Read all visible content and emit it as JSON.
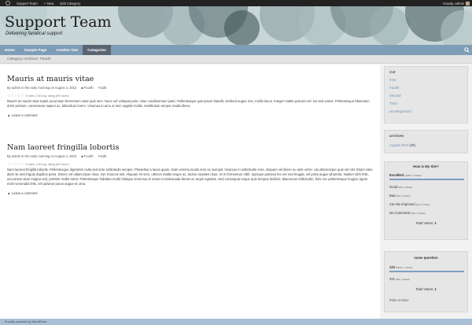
{
  "adminbar": {
    "site": "Support Team",
    "new": "New",
    "edit": "Edit Category",
    "howdy": "Howdy, admin"
  },
  "header": {
    "title": "Support Team",
    "description": "Delivering fanatical support"
  },
  "nav": {
    "items": [
      "Home",
      "Sample Page",
      "Another One",
      "Categories"
    ],
    "active_index": 3
  },
  "breadcrumb": "Category Archives: Fourth",
  "posts": [
    {
      "title": "Mauris at mauris vitae",
      "meta_by": "By admin in the early morning on August 4, 2013",
      "category": "Fourth",
      "edit": "Edit",
      "rating": "0 votes, 0.00 avg. rating (0% score)",
      "body": "Mauris at mauris vitae turpis accumsan fermentum vitae quis sem. Nunc vel volutpat justo, vitae condimentum justo. Pellentesque quis ipsum blandit, eleifend augue non, mollis lacus. Integer mattis posuere tel- lus sed varius. Pellentesque bibendum dolor pretium, consectetur sapien ac, bibendum lorem. Vivamus in arcu ut sem sagittis mollis. Vestibulum tempor mattis libero.",
      "comment": "Leave a comment"
    },
    {
      "title": "Nam laoreet fringilla lobortis",
      "meta_by": "By admin in the early morning on August 4, 2013",
      "category": "Fourth",
      "edit": "Edit",
      "rating": "0 votes, 0.00 avg. rating (0% score)",
      "body": "Nam laoreet fringilla lobortis. Pellentesque dignissim nulla sed ante sollicitudin semper. Phasellus a lacus quam. Nam viverra iaculis eros ac suscipit. Vivamus in sollicitudin eros. Aliquam vel libero eu ante vehic- ula ullamcorper quis vel nisl. Etiam vitae diam sit amet ligula dapibus porta. Donec vel ullamcorper risus, non rhoncus nisi. Aliquam mi sem, ultrices mattis neque ac, lacinia sodales risus. Ut in fermentum nibh. Quisque pulvinar leo vel erat feugiat, vel porta augue pharetra. Nullam nibh felis, accumsan vitae magna sed, porttitor mollis tortor. Pellentesque habitant morbi tristique senectus et netus et malesuada fames ac turpis egestas. Sed consequat neque quis tempus facilisis. Maecenas sollicitudin, felis nec pellentesque feugiat, ligula enim venenatis felis, vel pulvinar purus augue et urna.",
      "comment": "Leave a comment"
    }
  ],
  "sidebar": {
    "cat": {
      "title": "Cat",
      "items": [
        "First",
        "Fourth",
        "Second",
        "Third",
        "Uncategorized"
      ]
    },
    "archives": {
      "title": "archives",
      "link": "August 2013",
      "count": "(29)"
    },
    "poll1": {
      "question": "How is My Site?",
      "answers": [
        {
          "label": "Excellent",
          "stat": "(100%, 1 Votes)",
          "fraction": 1.0
        },
        {
          "label": "Good",
          "stat": "(0%, 0 Votes)",
          "fraction": 0
        },
        {
          "label": "Bad",
          "stat": "(0%, 0 Votes)",
          "fraction": 0
        },
        {
          "label": "Can Be Improved",
          "stat": "(0%, 0 Votes)",
          "fraction": 0
        },
        {
          "label": "No Comments",
          "stat": "(0%, 0 Votes)",
          "fraction": 0
        }
      ],
      "total_label": "Total Voters:",
      "total": "1"
    },
    "poll2": {
      "question": "some question",
      "answers": [
        {
          "label": "123",
          "stat": "(100%, 1 Votes)",
          "fraction": 1.0
        },
        {
          "label": "321",
          "stat": "(0%, 0 Votes)",
          "fraction": 0
        }
      ],
      "total_label": "Total Voters:",
      "total": "1",
      "archive": "Polls Archive"
    }
  },
  "footer": "Proudly powered by WordPress",
  "colors": {
    "nav": "#7e9db7",
    "nav_active": "#5a6571",
    "link": "#6f8fb0",
    "poll_fill": "#7f9fc0",
    "footer": "#a9c0d6"
  }
}
